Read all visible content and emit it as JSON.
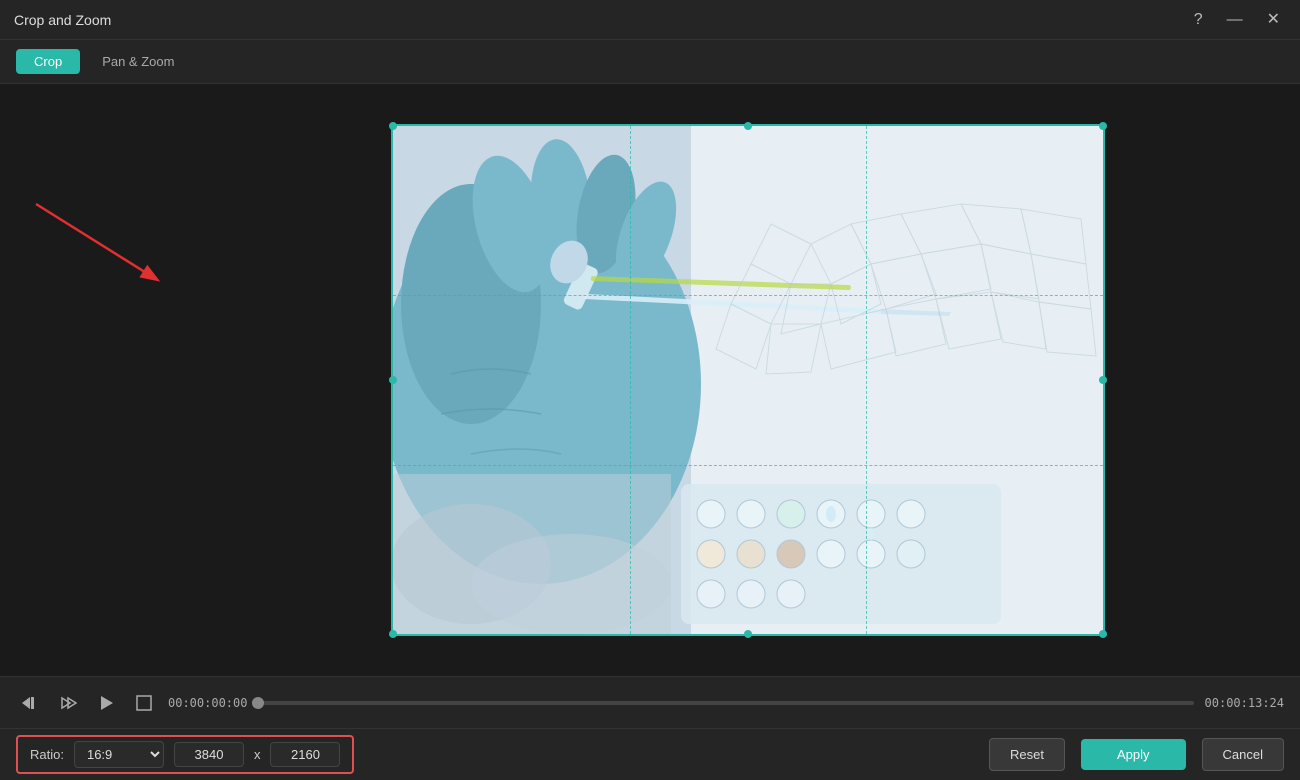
{
  "window": {
    "title": "Crop and Zoom"
  },
  "title_bar": {
    "title": "Crop and Zoom",
    "help_btn": "?",
    "minimize_btn": "—",
    "close_btn": "✕"
  },
  "tabs": [
    {
      "id": "crop",
      "label": "Crop",
      "active": true
    },
    {
      "id": "pan-zoom",
      "label": "Pan & Zoom",
      "active": false
    }
  ],
  "timeline": {
    "time_current": "00:00:00:00",
    "time_end": "00:00:13:24"
  },
  "ratio_section": {
    "label": "Ratio:",
    "ratio_value": "16:9",
    "width_value": "3840",
    "separator": "x",
    "height_value": "2160"
  },
  "buttons": {
    "reset": "Reset",
    "apply": "Apply",
    "cancel": "Cancel"
  },
  "icons": {
    "rewind": "⏮",
    "step_back": "⏭",
    "play": "▶",
    "square": "□"
  }
}
